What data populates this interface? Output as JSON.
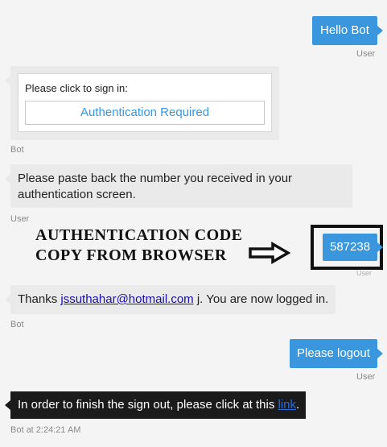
{
  "messages": {
    "hello": {
      "text": "Hello Bot",
      "sender": "User"
    },
    "signin_card": {
      "prompt": "Please click to sign in:",
      "button_label": "Authentication Required",
      "sender": "Bot"
    },
    "paste_request": {
      "line1": "Please paste back the number you received in your",
      "line2": "authentication screen.",
      "sender": "User"
    },
    "code": {
      "text": "587238",
      "sender": "User"
    },
    "thanks": {
      "prefix": "Thanks ",
      "email": "jssuthahar@hotmail.com",
      "suffix": " j. You are now logged in.",
      "sender": "Bot"
    },
    "logout": {
      "text": "Please logout",
      "sender": "User"
    },
    "signout": {
      "prefix": "In order to finish the sign out, please click at this ",
      "link": "link",
      "suffix": ".",
      "timestamp": "Bot at 2:24:21 AM"
    }
  },
  "annotation": {
    "line1": "AUTHENTICATION CODE",
    "line2": "COPY FROM BROWSER",
    "arrow_icon": "right-arrow-icon"
  },
  "colors": {
    "user_bubble": "#3a96dd",
    "bot_bubble": "#eaeaea",
    "tooltip_bg": "#1b1b1b",
    "link": "#1a0dab"
  }
}
